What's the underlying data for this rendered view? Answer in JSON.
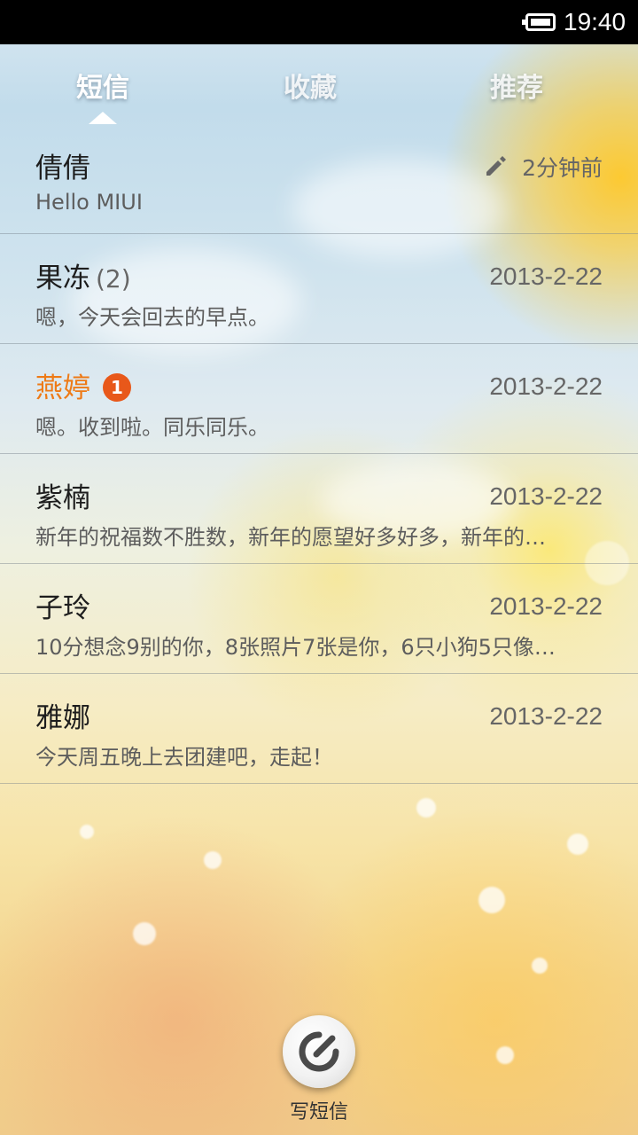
{
  "status_bar": {
    "time": "19:40"
  },
  "tabs": [
    {
      "label": "短信",
      "active": true
    },
    {
      "label": "收藏",
      "active": false
    },
    {
      "label": "推荐",
      "active": false
    }
  ],
  "conversations": [
    {
      "name": "倩倩",
      "preview": "Hello MIUI",
      "draft": true,
      "time": "2分钟前"
    },
    {
      "name": "果冻",
      "count": "(2)",
      "preview": "嗯，今天会回去的早点。",
      "date": "2013-2-22"
    },
    {
      "name": "燕婷",
      "unread_badge": "1",
      "preview": "嗯。收到啦。同乐同乐。",
      "date": "2013-2-22"
    },
    {
      "name": "紫楠",
      "preview": "新年的祝福数不胜数，新年的愿望好多好多，新年的…",
      "date": "2013-2-22"
    },
    {
      "name": "子玲",
      "preview": "10分想念9别的你，8张照片7张是你，6只小狗5只像…",
      "date": "2013-2-22"
    },
    {
      "name": "雅娜",
      "preview": "今天周五晚上去团建吧，走起！",
      "date": "2013-2-22"
    }
  ],
  "compose": {
    "label": "写短信"
  },
  "icons": {
    "battery": "battery-icon",
    "draft": "pencil-icon",
    "compose": "compose-icon"
  },
  "colors": {
    "unread_name": "#ee7a16",
    "badge": "#e8581a"
  }
}
